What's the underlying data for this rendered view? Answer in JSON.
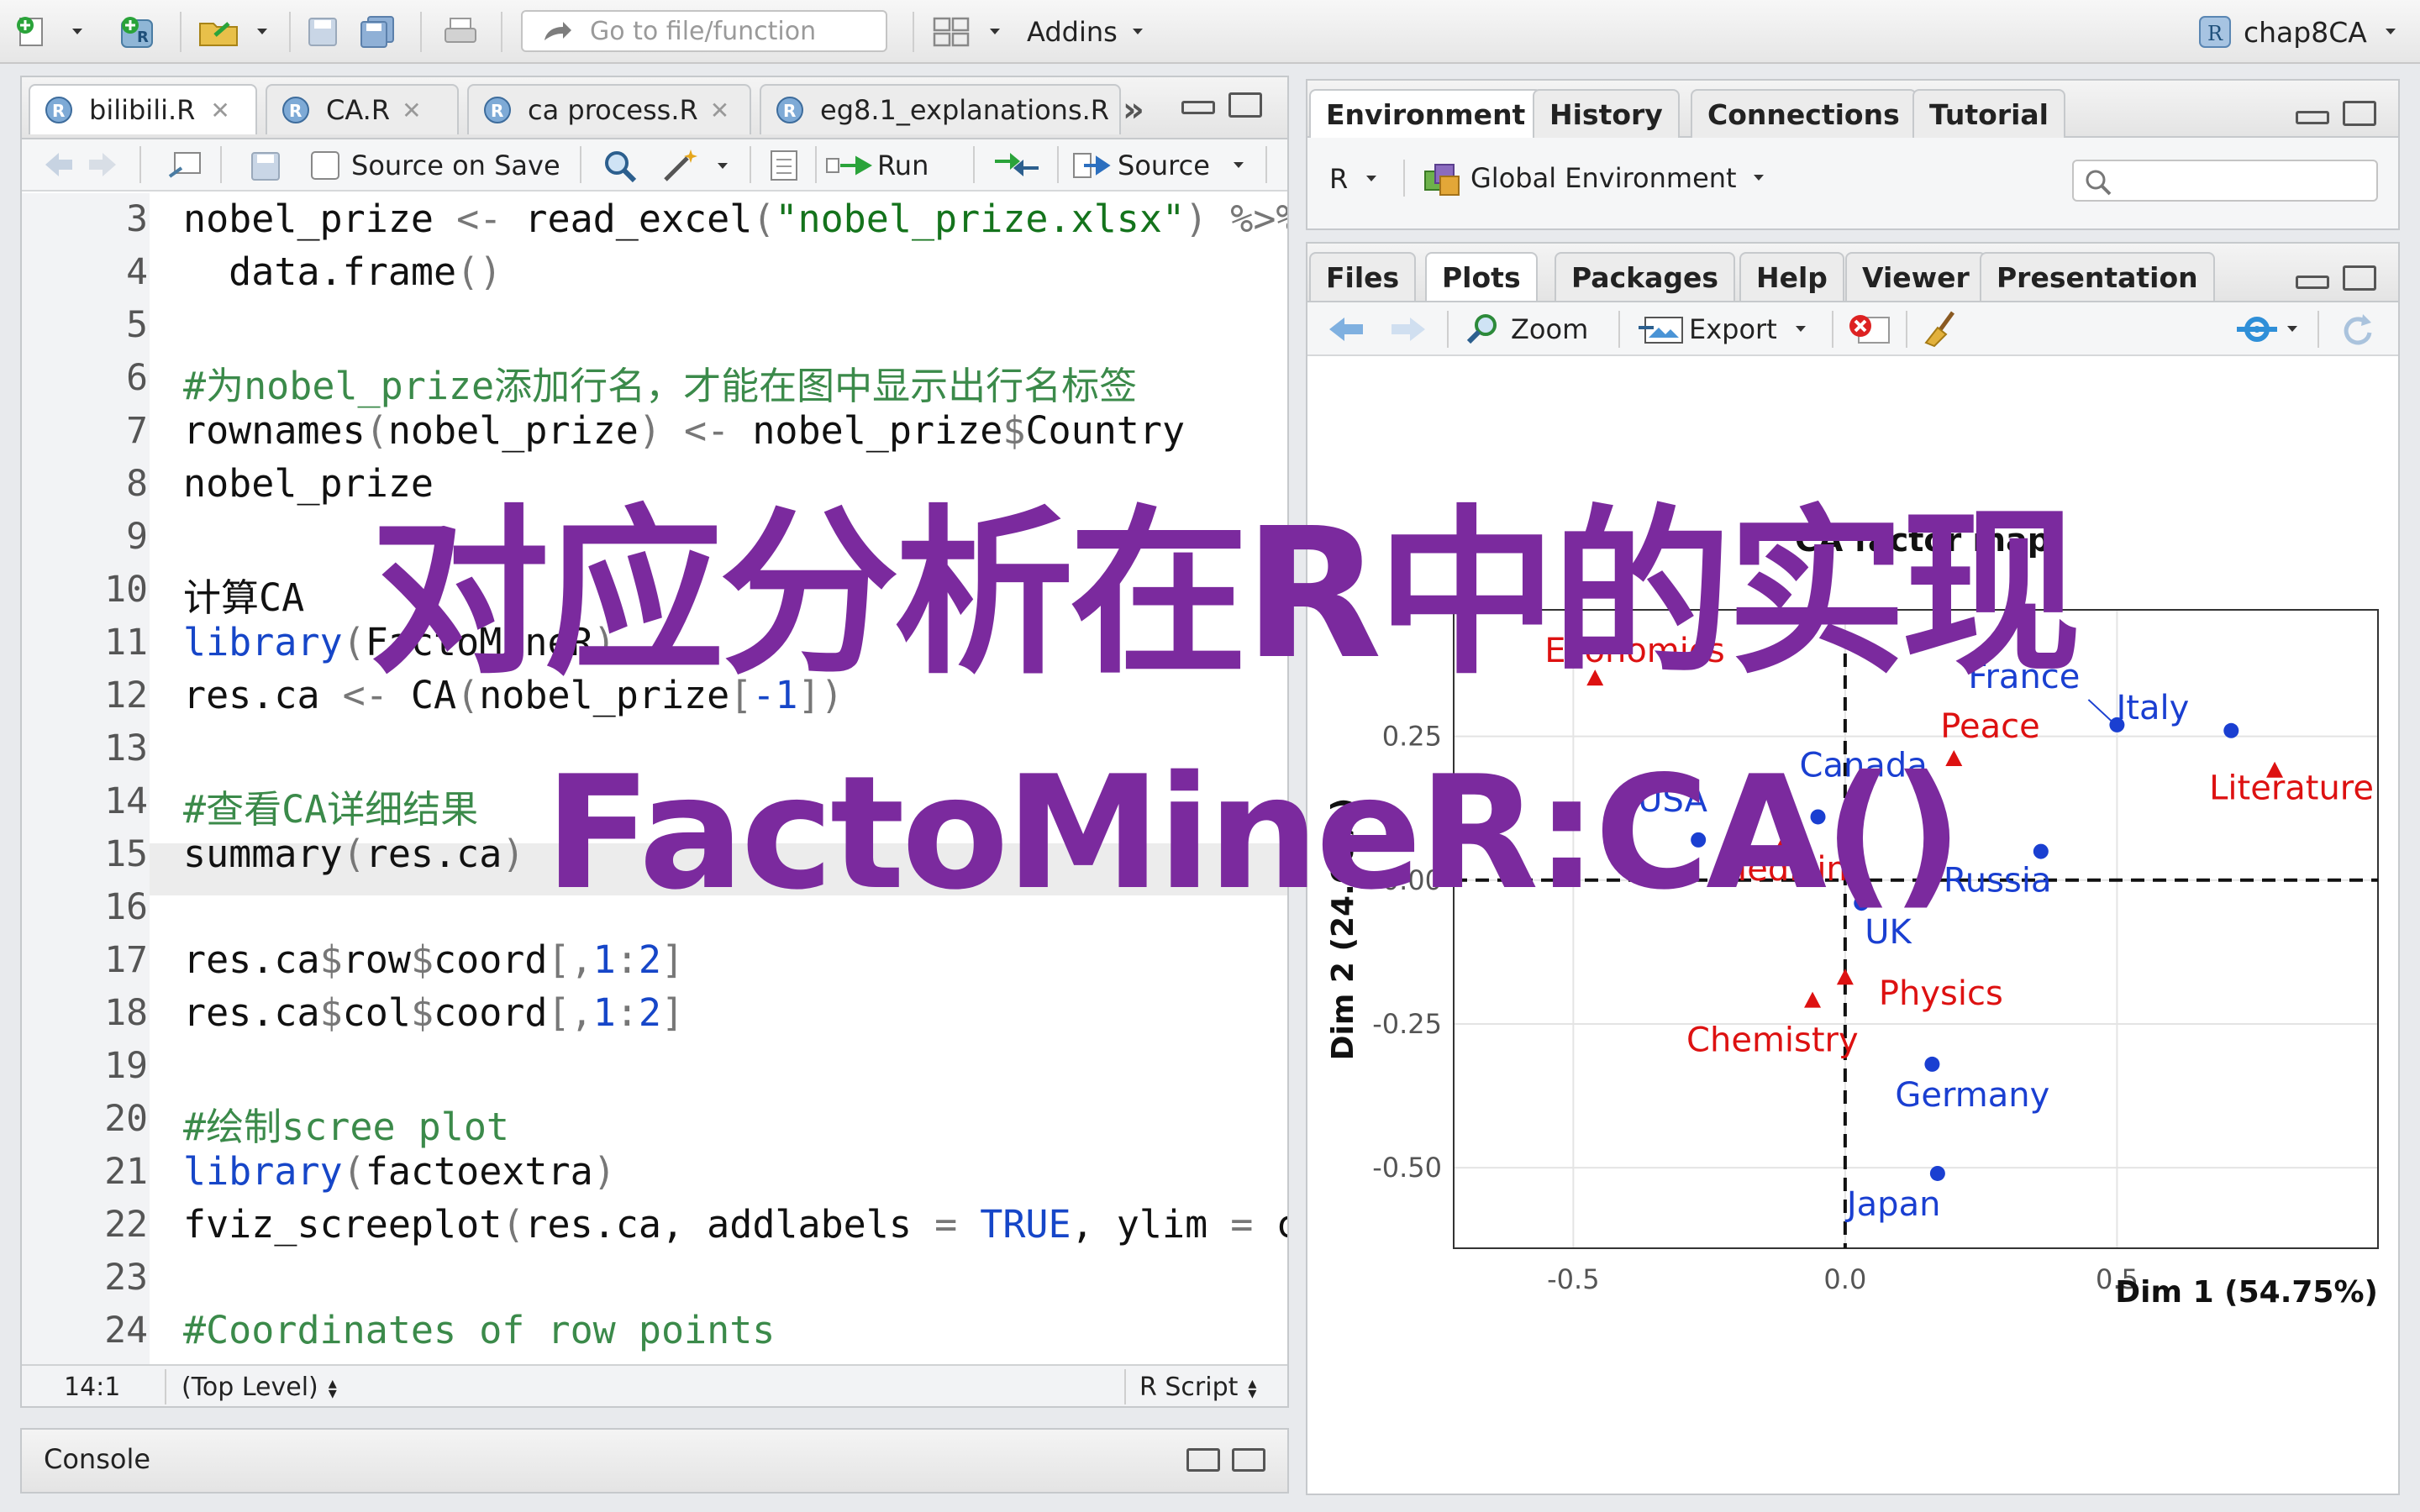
{
  "toolbar": {
    "goto_placeholder": "Go to file/function",
    "addins_label": "Addins",
    "project_label": "chap8CA"
  },
  "editor": {
    "tabs": [
      {
        "label": "bilibili.R"
      },
      {
        "label": "CA.R"
      },
      {
        "label": "ca process.R"
      },
      {
        "label": "eg8.1_explanations.R"
      }
    ],
    "source_on_save": "Source on Save",
    "run_label": "Run",
    "source_label": "Source",
    "line_numbers": [
      "3",
      "4",
      "5",
      "6",
      "7",
      "8",
      "9",
      "10",
      "11",
      "12",
      "13",
      "14",
      "15",
      "16",
      "17",
      "18",
      "19",
      "20",
      "21",
      "22",
      "23",
      "24"
    ],
    "status": {
      "position": "14:1",
      "scope": "(Top Level)",
      "filetype": "R Script"
    }
  },
  "console": {
    "label": "Console"
  },
  "env_pane": {
    "tabs": [
      "Environment",
      "History",
      "Connections",
      "Tutorial"
    ],
    "lang": "R",
    "scope": "Global Environment"
  },
  "files_pane": {
    "tabs": [
      "Files",
      "Plots",
      "Packages",
      "Help",
      "Viewer",
      "Presentation"
    ],
    "zoom_label": "Zoom",
    "export_label": "Export"
  },
  "overlay": {
    "title_cn": "对应分析在R中的实现",
    "title_fn": "FactoMineR:CA()"
  },
  "colors": {
    "row_points": "#1a3fd1",
    "col_points": "#dd1111",
    "overlay": "#7b2a9e"
  },
  "chart_data": {
    "type": "scatter",
    "title": "CA factor map",
    "xlabel": "Dim 1 (54.75%)",
    "ylabel": "Dim 2 (24.60%)",
    "xlim": [
      -0.72,
      0.98
    ],
    "ylim": [
      -0.64,
      0.47
    ],
    "xticks": [
      "-0.5",
      "0.0",
      "0.5"
    ],
    "yticks": [
      "0.25",
      "0.00",
      "-0.25",
      "-0.50"
    ],
    "series": [
      {
        "name": "Country",
        "marker": "circle",
        "points": [
          {
            "label": "France",
            "x": 0.5,
            "y": 0.27
          },
          {
            "label": "Italy",
            "x": 0.71,
            "y": 0.26
          },
          {
            "label": "Canada",
            "x": -0.05,
            "y": 0.11
          },
          {
            "label": "USA",
            "x": -0.27,
            "y": 0.07
          },
          {
            "label": "Russia",
            "x": 0.36,
            "y": 0.05
          },
          {
            "label": "UK",
            "x": 0.03,
            "y": -0.04
          },
          {
            "label": "Germany",
            "x": 0.16,
            "y": -0.32
          },
          {
            "label": "Japan",
            "x": 0.17,
            "y": -0.51
          }
        ]
      },
      {
        "name": "Prize",
        "marker": "triangle",
        "points": [
          {
            "label": "Economics",
            "x": -0.46,
            "y": 0.35
          },
          {
            "label": "Peace",
            "x": 0.2,
            "y": 0.21
          },
          {
            "label": "Literature",
            "x": 0.79,
            "y": 0.19
          },
          {
            "label": "Medicine",
            "x": -0.11,
            "y": 0.07
          },
          {
            "label": "Physics",
            "x": 0.0,
            "y": -0.17
          },
          {
            "label": "Chemistry",
            "x": -0.06,
            "y": -0.21
          }
        ]
      }
    ]
  }
}
